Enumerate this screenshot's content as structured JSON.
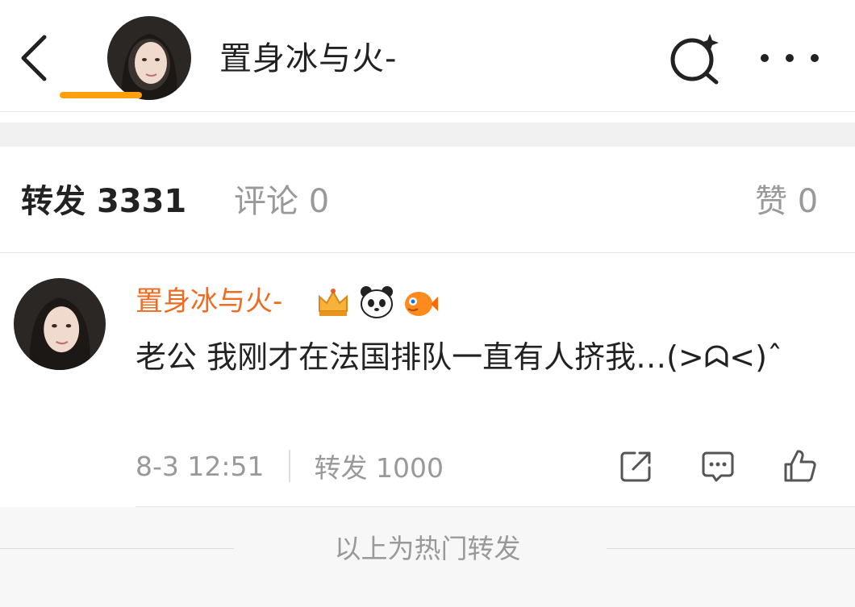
{
  "header": {
    "title": "置身冰与火-",
    "back_icon": "chevron-left-icon",
    "search_icon": "search-sparkle-icon",
    "more_icon": "more-dots-icon"
  },
  "tabs": [
    {
      "label": "转发",
      "count": "3331",
      "active": true
    },
    {
      "label": "评论",
      "count": "0",
      "active": false
    },
    {
      "label": "赞",
      "count": "0",
      "active": false
    }
  ],
  "post": {
    "username": "置身冰与火-",
    "badges": [
      "crown-badge-icon",
      "panda-badge-icon",
      "fish-badge-icon"
    ],
    "text": "老公 我刚才在法国排队一直有人挤我…(>ᗣ<)ˆ",
    "time": "8-3 12:51",
    "repost_label": "转发 1000"
  },
  "footer": {
    "text": "以上为热门转发"
  },
  "colors": {
    "accent": "#ffa00a",
    "username": "#f06b1f",
    "muted": "#999999"
  }
}
